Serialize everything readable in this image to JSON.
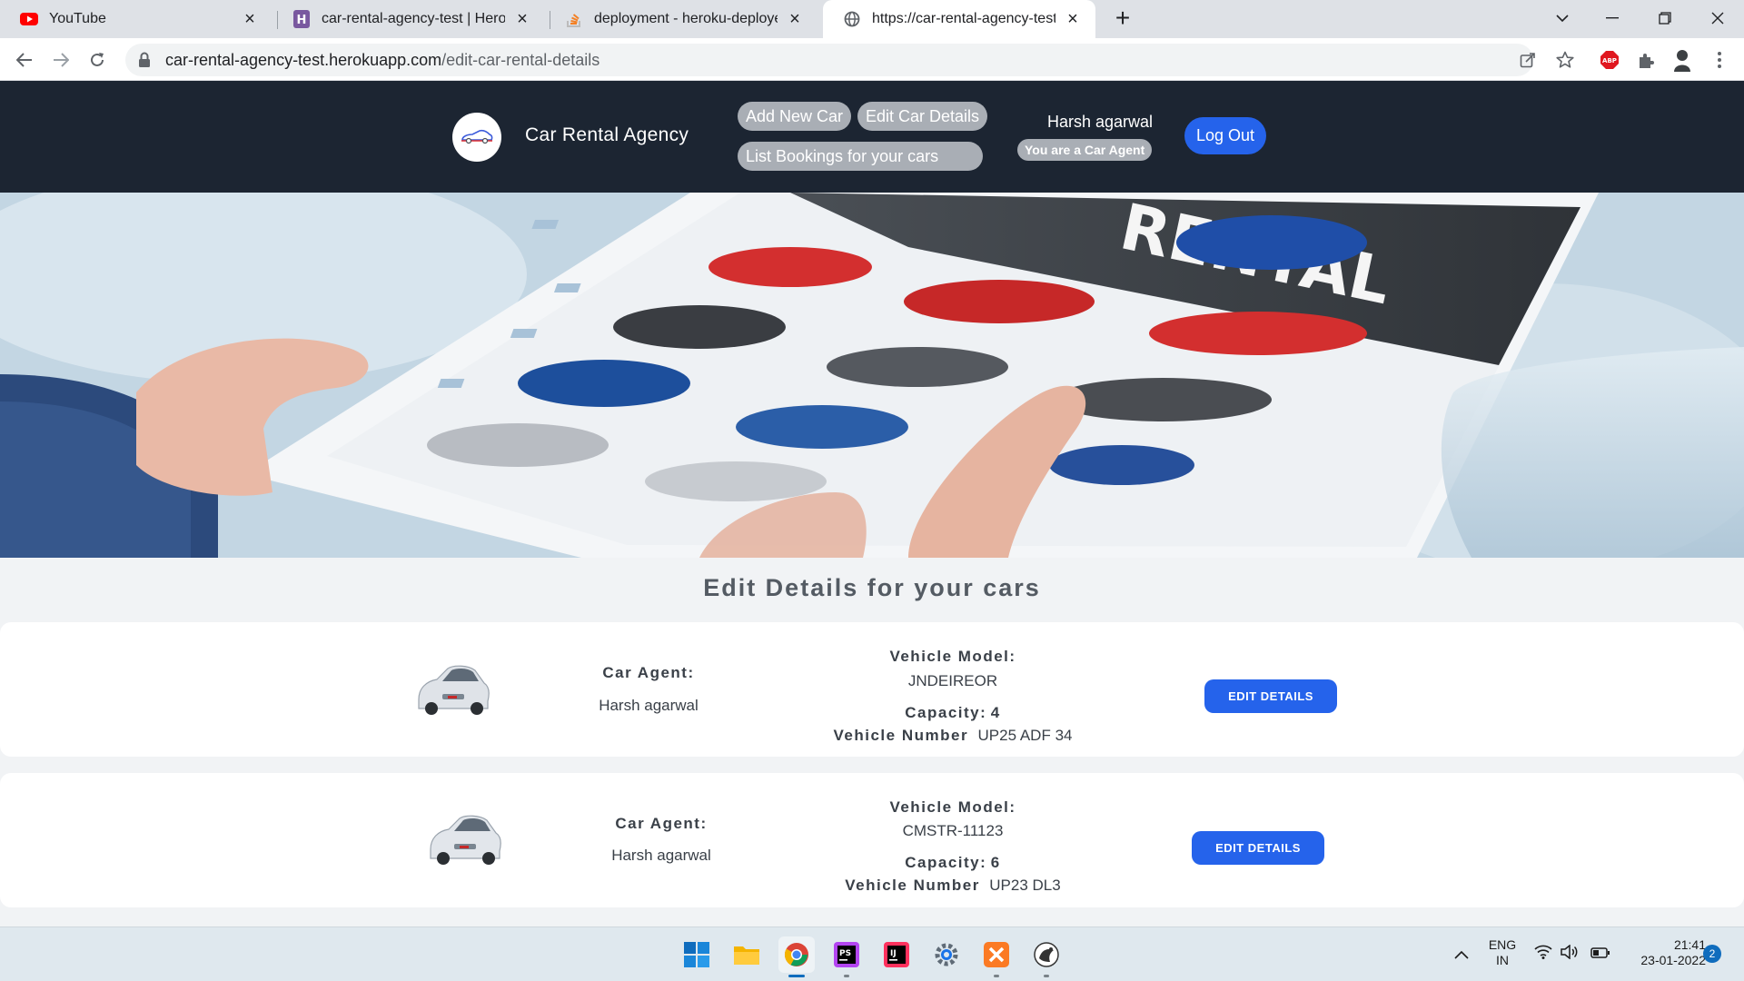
{
  "browser": {
    "tabs": [
      {
        "title": "YouTube",
        "icon": "youtube-icon",
        "active": false
      },
      {
        "title": "car-rental-agency-test | Heroku",
        "icon": "heroku-icon",
        "active": false
      },
      {
        "title": "deployment - heroku-deployed a",
        "icon": "stackoverflow-icon",
        "active": false
      },
      {
        "title": "https://car-rental-agency-test.he",
        "icon": "globe-icon",
        "active": true
      }
    ],
    "url_host": "car-rental-agency-test.herokuapp.com",
    "url_path": "/edit-car-rental-details"
  },
  "header": {
    "brand": "Car Rental Agency",
    "nav": {
      "add_car": "Add New Car",
      "edit_car": "Edit Car Details",
      "list_bookings": "List Bookings for your cars"
    },
    "user_name": "Harsh agarwal",
    "role_badge": "You are a Car Agent",
    "logout": "Log Out"
  },
  "page": {
    "title": "Edit Details for your cars",
    "agent_label": "Car Agent:",
    "model_label": "Vehicle Model:",
    "capacity_label": "Capacity:",
    "number_label": "Vehicle Number",
    "edit_button": "EDIT DETAILS",
    "cars": [
      {
        "agent": "Harsh agarwal",
        "model": "JNDEIREOR",
        "capacity": "4",
        "number": "UP25 ADF 34"
      },
      {
        "agent": "Harsh agarwal",
        "model": "CMSTR-11123",
        "capacity": "6",
        "number": "UP23 DL3"
      }
    ]
  },
  "taskbar": {
    "apps": [
      "windows-start-icon",
      "file-explorer-icon",
      "chrome-icon",
      "phpstorm-icon",
      "intellij-icon",
      "settings-icon",
      "xampp-icon",
      "app-icon"
    ],
    "lang_top": "ENG",
    "lang_bottom": "IN",
    "time": "21:41",
    "date": "23-01-2022",
    "notifications": "2"
  },
  "colors": {
    "header_bg": "#1c2532",
    "accent": "#2563eb",
    "pill_bg": "#a9aeb5"
  }
}
